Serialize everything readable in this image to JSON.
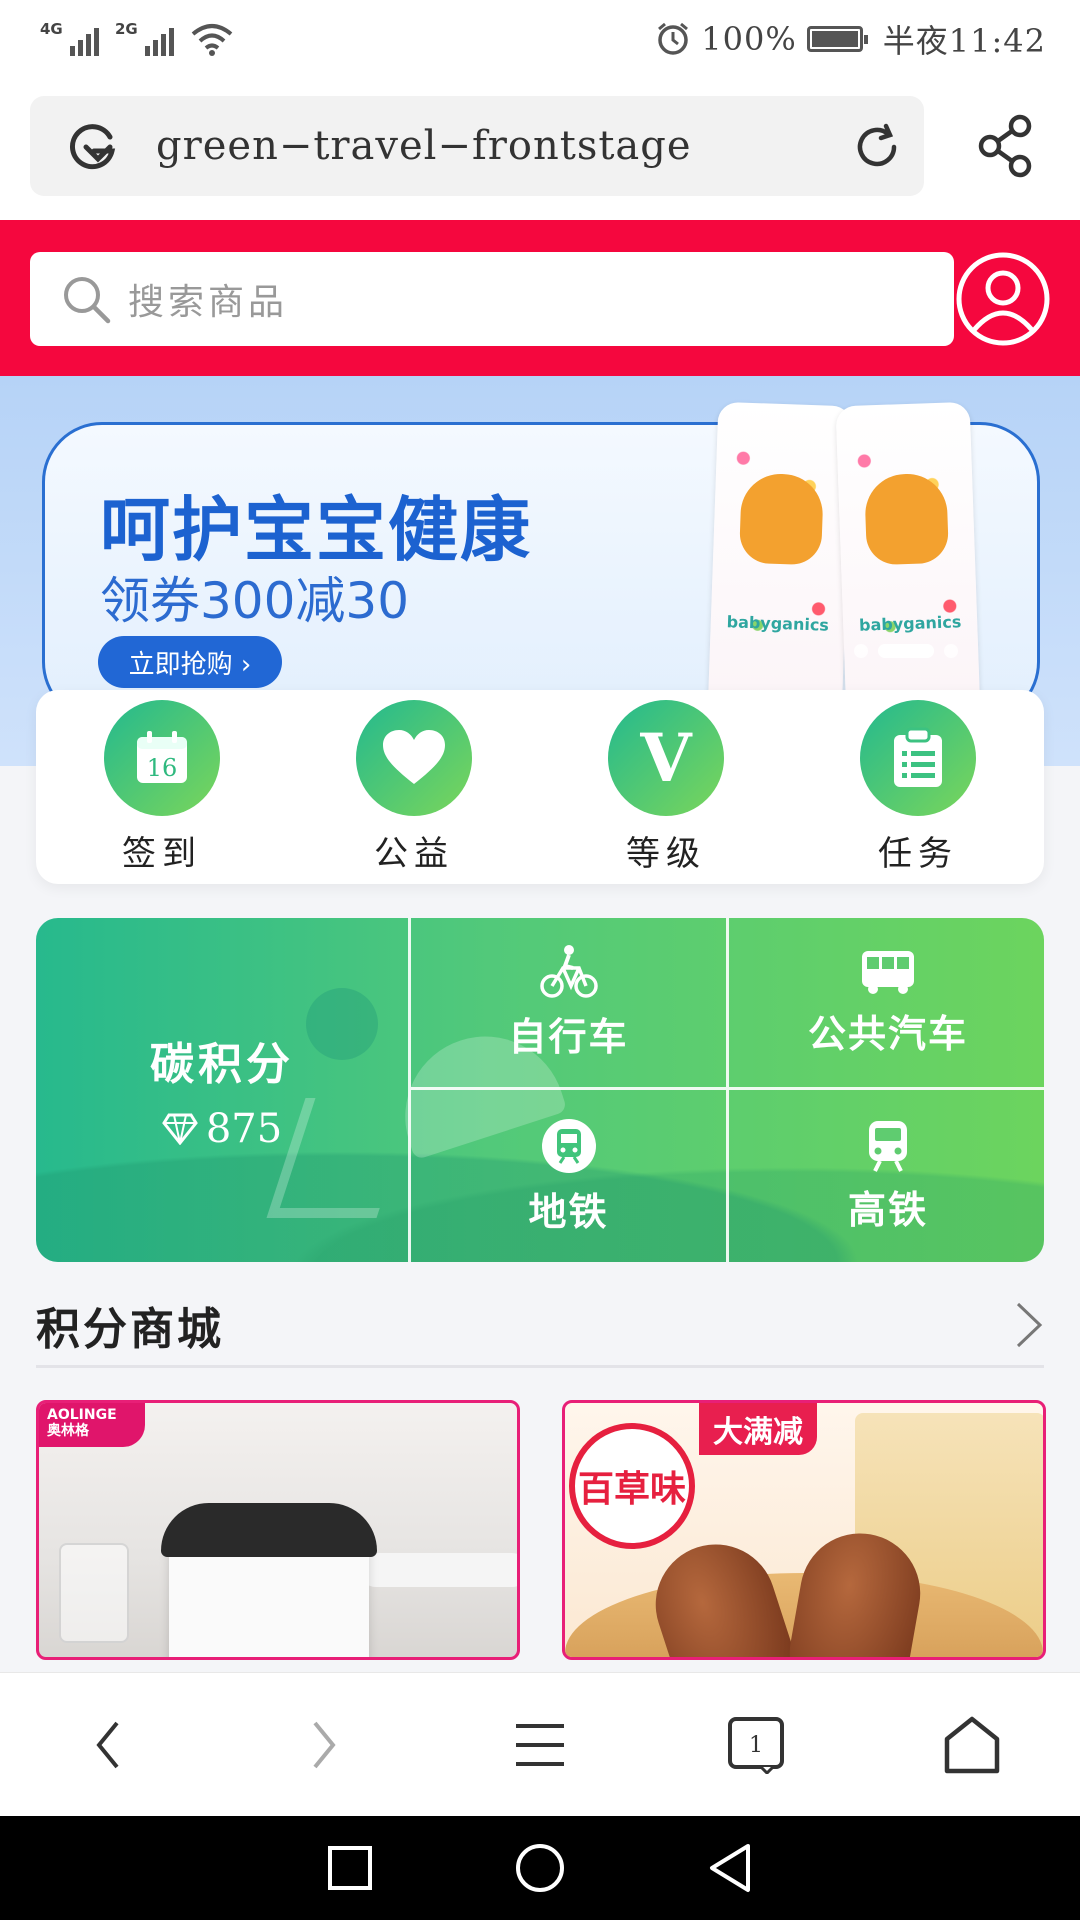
{
  "status_bar": {
    "network1": "4G",
    "network2": "2G",
    "battery": "100%",
    "time": "半夜11:42"
  },
  "browser": {
    "url": "green−travel−frontstage"
  },
  "header": {
    "search_placeholder": "搜索商品"
  },
  "banner": {
    "title": "呵护宝宝健康",
    "subtitle": "领券300减30",
    "button": "立即抢购 ›",
    "product_brand": "babyganics"
  },
  "quick_menu": [
    {
      "label": "签到",
      "icon": "calendar-icon",
      "number": "16"
    },
    {
      "label": "公益",
      "icon": "heart-icon"
    },
    {
      "label": "等级",
      "icon": "level-v-icon",
      "letter": "V"
    },
    {
      "label": "任务",
      "icon": "clipboard-icon"
    }
  ],
  "carbon": {
    "title": "碳积分",
    "points": "875",
    "transport": [
      {
        "label": "自行车",
        "icon": "bicycle-icon"
      },
      {
        "label": "公共汽车",
        "icon": "bus-icon"
      },
      {
        "label": "地铁",
        "icon": "metro-icon"
      },
      {
        "label": "高铁",
        "icon": "train-icon"
      }
    ]
  },
  "mall": {
    "title": "积分商城",
    "products": [
      {
        "brand_en": "AOLINGE",
        "brand_cn": "奥林格"
      },
      {
        "badge": "大满减",
        "logo": "百草味"
      }
    ]
  },
  "colors": {
    "brand_red": "#f5073e",
    "green_start": "#23b98f",
    "green_end": "#7bd65a",
    "banner_blue": "#1c62d0"
  }
}
